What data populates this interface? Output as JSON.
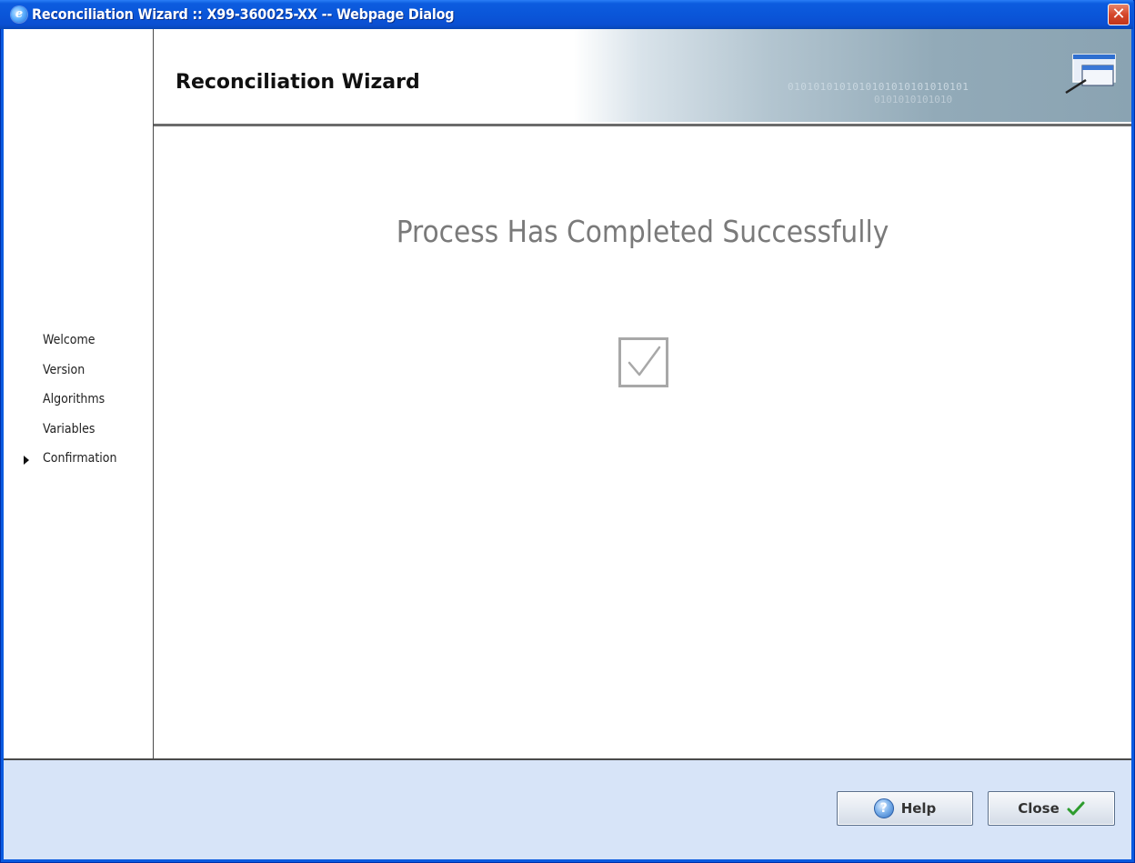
{
  "window": {
    "title": "Reconciliation Wizard :: X99-360025-XX -- Webpage Dialog",
    "close_glyph": "✕"
  },
  "header": {
    "title": "Reconciliation Wizard",
    "binary_text_1": "0101010101010101010101010101",
    "binary_text_2": "0101010101010"
  },
  "nav": {
    "items": [
      {
        "label": "Welcome",
        "active": false
      },
      {
        "label": "Version",
        "active": false
      },
      {
        "label": "Algorithms",
        "active": false
      },
      {
        "label": "Variables",
        "active": false
      },
      {
        "label": "Confirmation",
        "active": true
      }
    ]
  },
  "main": {
    "message": "Process Has Completed Successfully"
  },
  "footer": {
    "help_label": "Help",
    "close_label": "Close"
  },
  "colors": {
    "titlebar": "#0a55d8",
    "footer_bg": "#d7e4f8",
    "heading_gray": "#7a7a7a",
    "check_green": "#2e9c2e"
  },
  "icons": {
    "app": "ie-icon",
    "close": "close-icon",
    "banner": "windows-icon",
    "success": "checkbox-checked-icon",
    "help": "help-icon",
    "confirm": "checkmark-icon"
  }
}
